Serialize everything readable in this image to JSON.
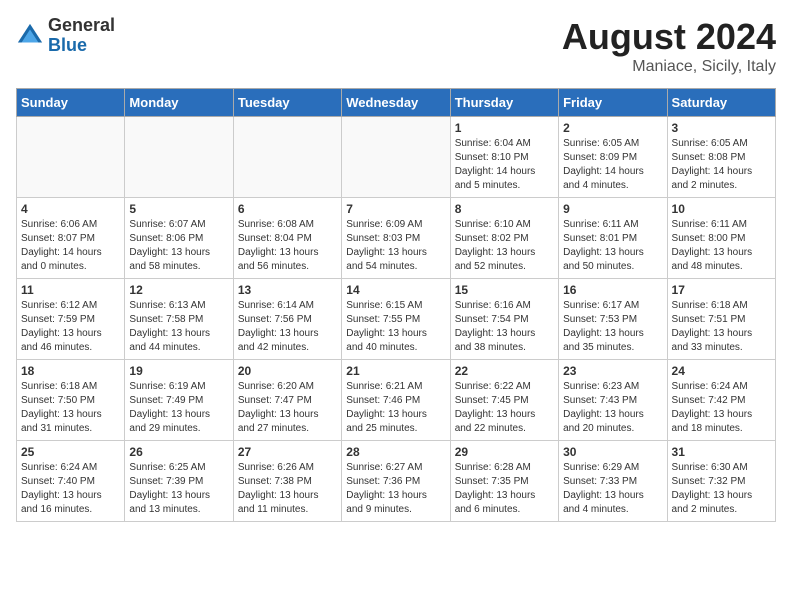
{
  "logo": {
    "general": "General",
    "blue": "Blue"
  },
  "title": {
    "month_year": "August 2024",
    "location": "Maniace, Sicily, Italy"
  },
  "days_of_week": [
    "Sunday",
    "Monday",
    "Tuesday",
    "Wednesday",
    "Thursday",
    "Friday",
    "Saturday"
  ],
  "weeks": [
    [
      {
        "day": "",
        "info": ""
      },
      {
        "day": "",
        "info": ""
      },
      {
        "day": "",
        "info": ""
      },
      {
        "day": "",
        "info": ""
      },
      {
        "day": "1",
        "info": "Sunrise: 6:04 AM\nSunset: 8:10 PM\nDaylight: 14 hours and 5 minutes."
      },
      {
        "day": "2",
        "info": "Sunrise: 6:05 AM\nSunset: 8:09 PM\nDaylight: 14 hours and 4 minutes."
      },
      {
        "day": "3",
        "info": "Sunrise: 6:05 AM\nSunset: 8:08 PM\nDaylight: 14 hours and 2 minutes."
      }
    ],
    [
      {
        "day": "4",
        "info": "Sunrise: 6:06 AM\nSunset: 8:07 PM\nDaylight: 14 hours and 0 minutes."
      },
      {
        "day": "5",
        "info": "Sunrise: 6:07 AM\nSunset: 8:06 PM\nDaylight: 13 hours and 58 minutes."
      },
      {
        "day": "6",
        "info": "Sunrise: 6:08 AM\nSunset: 8:04 PM\nDaylight: 13 hours and 56 minutes."
      },
      {
        "day": "7",
        "info": "Sunrise: 6:09 AM\nSunset: 8:03 PM\nDaylight: 13 hours and 54 minutes."
      },
      {
        "day": "8",
        "info": "Sunrise: 6:10 AM\nSunset: 8:02 PM\nDaylight: 13 hours and 52 minutes."
      },
      {
        "day": "9",
        "info": "Sunrise: 6:11 AM\nSunset: 8:01 PM\nDaylight: 13 hours and 50 minutes."
      },
      {
        "day": "10",
        "info": "Sunrise: 6:11 AM\nSunset: 8:00 PM\nDaylight: 13 hours and 48 minutes."
      }
    ],
    [
      {
        "day": "11",
        "info": "Sunrise: 6:12 AM\nSunset: 7:59 PM\nDaylight: 13 hours and 46 minutes."
      },
      {
        "day": "12",
        "info": "Sunrise: 6:13 AM\nSunset: 7:58 PM\nDaylight: 13 hours and 44 minutes."
      },
      {
        "day": "13",
        "info": "Sunrise: 6:14 AM\nSunset: 7:56 PM\nDaylight: 13 hours and 42 minutes."
      },
      {
        "day": "14",
        "info": "Sunrise: 6:15 AM\nSunset: 7:55 PM\nDaylight: 13 hours and 40 minutes."
      },
      {
        "day": "15",
        "info": "Sunrise: 6:16 AM\nSunset: 7:54 PM\nDaylight: 13 hours and 38 minutes."
      },
      {
        "day": "16",
        "info": "Sunrise: 6:17 AM\nSunset: 7:53 PM\nDaylight: 13 hours and 35 minutes."
      },
      {
        "day": "17",
        "info": "Sunrise: 6:18 AM\nSunset: 7:51 PM\nDaylight: 13 hours and 33 minutes."
      }
    ],
    [
      {
        "day": "18",
        "info": "Sunrise: 6:18 AM\nSunset: 7:50 PM\nDaylight: 13 hours and 31 minutes."
      },
      {
        "day": "19",
        "info": "Sunrise: 6:19 AM\nSunset: 7:49 PM\nDaylight: 13 hours and 29 minutes."
      },
      {
        "day": "20",
        "info": "Sunrise: 6:20 AM\nSunset: 7:47 PM\nDaylight: 13 hours and 27 minutes."
      },
      {
        "day": "21",
        "info": "Sunrise: 6:21 AM\nSunset: 7:46 PM\nDaylight: 13 hours and 25 minutes."
      },
      {
        "day": "22",
        "info": "Sunrise: 6:22 AM\nSunset: 7:45 PM\nDaylight: 13 hours and 22 minutes."
      },
      {
        "day": "23",
        "info": "Sunrise: 6:23 AM\nSunset: 7:43 PM\nDaylight: 13 hours and 20 minutes."
      },
      {
        "day": "24",
        "info": "Sunrise: 6:24 AM\nSunset: 7:42 PM\nDaylight: 13 hours and 18 minutes."
      }
    ],
    [
      {
        "day": "25",
        "info": "Sunrise: 6:24 AM\nSunset: 7:40 PM\nDaylight: 13 hours and 16 minutes."
      },
      {
        "day": "26",
        "info": "Sunrise: 6:25 AM\nSunset: 7:39 PM\nDaylight: 13 hours and 13 minutes."
      },
      {
        "day": "27",
        "info": "Sunrise: 6:26 AM\nSunset: 7:38 PM\nDaylight: 13 hours and 11 minutes."
      },
      {
        "day": "28",
        "info": "Sunrise: 6:27 AM\nSunset: 7:36 PM\nDaylight: 13 hours and 9 minutes."
      },
      {
        "day": "29",
        "info": "Sunrise: 6:28 AM\nSunset: 7:35 PM\nDaylight: 13 hours and 6 minutes."
      },
      {
        "day": "30",
        "info": "Sunrise: 6:29 AM\nSunset: 7:33 PM\nDaylight: 13 hours and 4 minutes."
      },
      {
        "day": "31",
        "info": "Sunrise: 6:30 AM\nSunset: 7:32 PM\nDaylight: 13 hours and 2 minutes."
      }
    ]
  ]
}
